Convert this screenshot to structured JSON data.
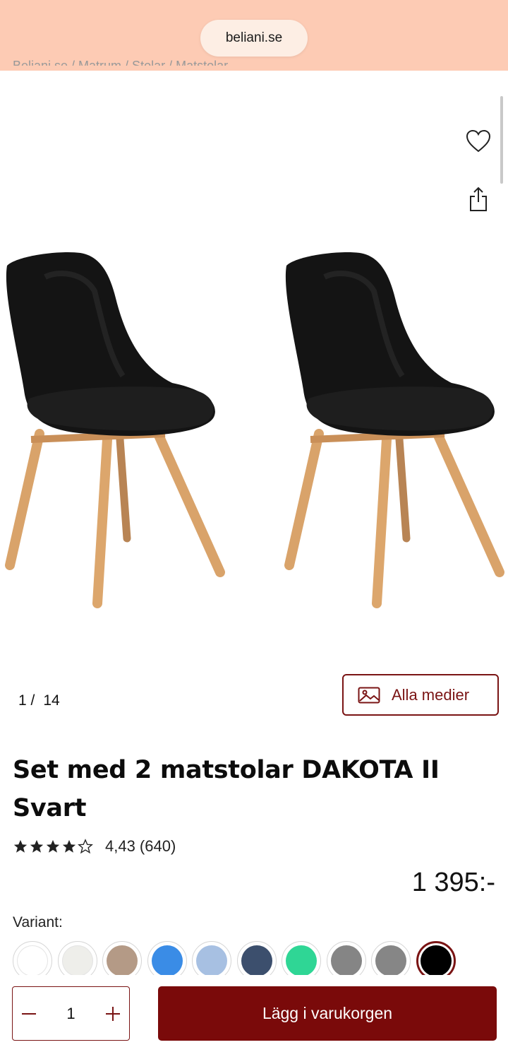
{
  "browser": {
    "url": "beliani.se"
  },
  "breadcrumb": "Beliani.se / Matrum / Stolar / Matstolar",
  "gallery": {
    "current": "1 /",
    "total": "14",
    "all_media_label": "Alla medier"
  },
  "product": {
    "title": "Set med 2 matstolar DAKOTA II Svart",
    "rating": 4.43,
    "rating_text": "4,43 (640)",
    "price": "1 395:-"
  },
  "variant": {
    "label": "Variant:",
    "swatches": [
      {
        "color": "#ffffff"
      },
      {
        "color": "#eeeeea"
      },
      {
        "color": "#b49a86"
      },
      {
        "color": "#3a8ce6"
      },
      {
        "color": "#a7c0e2"
      },
      {
        "color": "#3c4f6d"
      },
      {
        "color": "#2fd695"
      },
      {
        "color": "#858585"
      },
      {
        "color": "#868686"
      },
      {
        "color": "#000000",
        "selected": true
      }
    ]
  },
  "cart": {
    "quantity": "1",
    "add_label": "Lägg i varukorgen"
  },
  "colors": {
    "accent": "#7a0a0a",
    "topbar": "#fdcbb4"
  },
  "icons": {
    "wishlist": "heart-icon",
    "share": "share-icon",
    "media": "image-icon",
    "minus": "minus-icon",
    "plus": "plus-icon"
  }
}
